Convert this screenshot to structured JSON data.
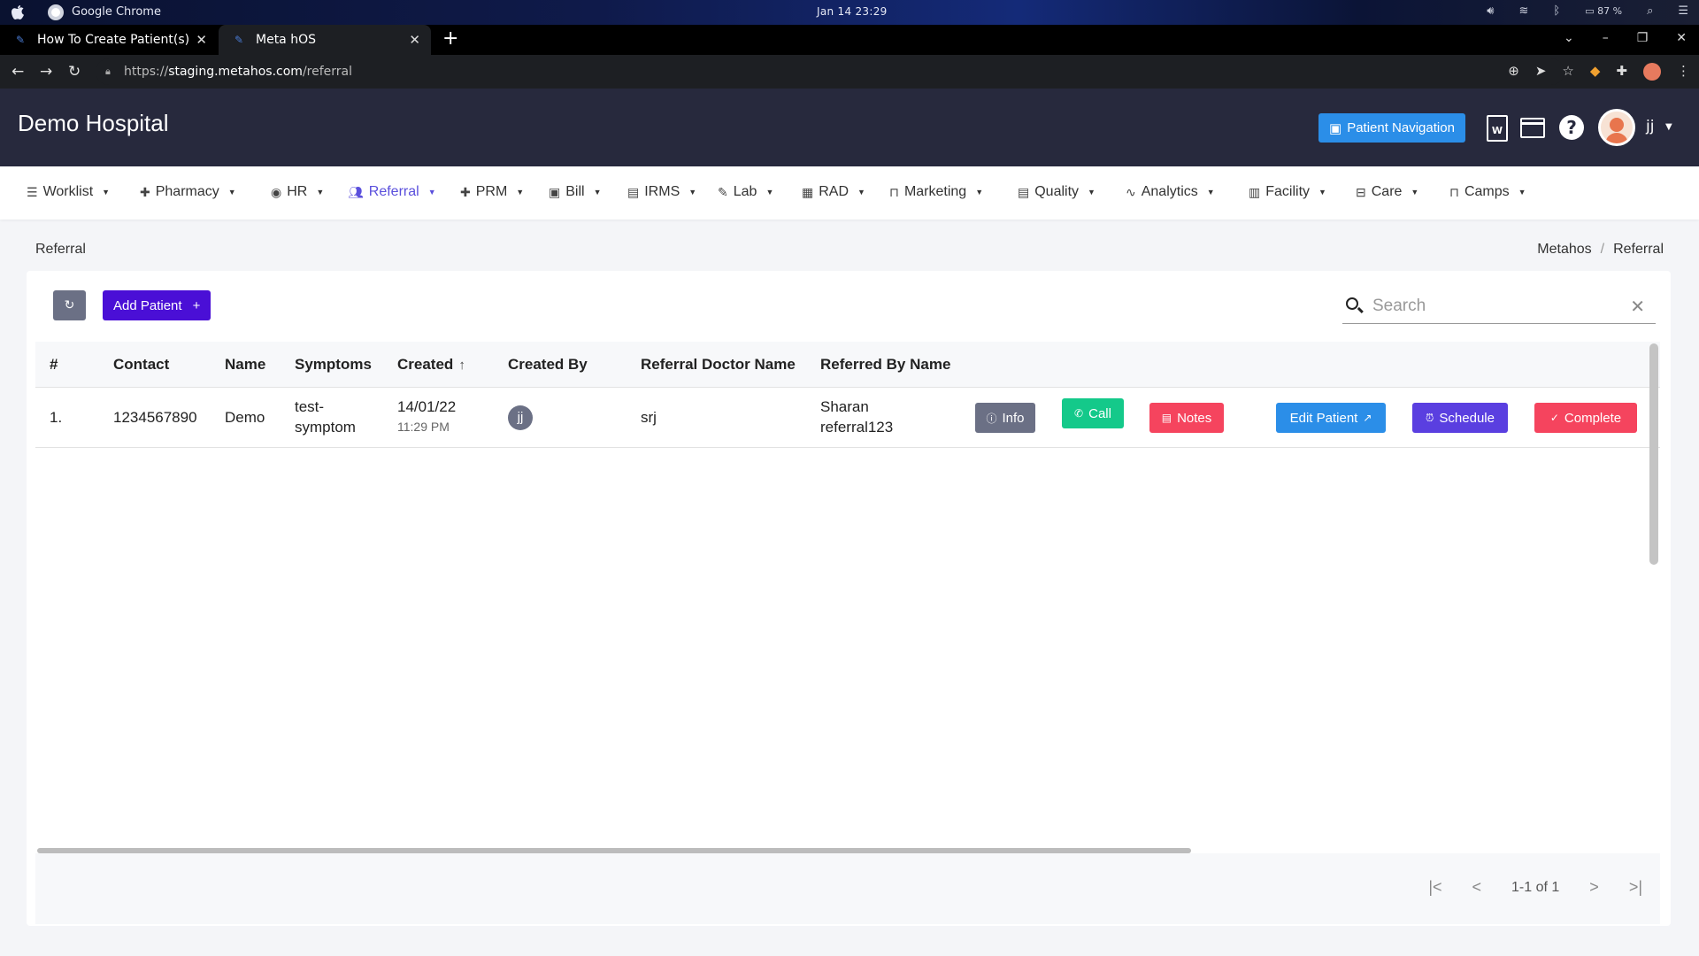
{
  "os": {
    "app_name": "Google Chrome",
    "clock": "Jan 14  23:29",
    "battery": "87 %",
    "icons": [
      "volume-icon",
      "wifi-icon",
      "bluetooth-icon",
      "battery-icon",
      "search-icon",
      "settings-icon"
    ]
  },
  "browser": {
    "tabs": [
      {
        "title": "How To Create Patient(s)"
      },
      {
        "title": "Meta hOS"
      }
    ],
    "url_scheme": "https://",
    "url_host": "staging.metahos.com",
    "url_path": "/referral"
  },
  "header": {
    "title": "Demo Hospital",
    "patient_nav_label": "Patient Navigation",
    "doc_icon_letter": "W",
    "help_label": "?",
    "user_name": "jj"
  },
  "menu": [
    {
      "label": "Worklist",
      "icon": "list-icon"
    },
    {
      "label": "Pharmacy",
      "icon": "plus-icon"
    },
    {
      "label": "HR",
      "icon": "user-circle-icon"
    },
    {
      "label": "Referral",
      "icon": "users-icon",
      "active": true
    },
    {
      "label": "PRM",
      "icon": "plus-icon"
    },
    {
      "label": "Bill",
      "icon": "money-icon"
    },
    {
      "label": "IRMS",
      "icon": "form-icon"
    },
    {
      "label": "Lab",
      "icon": "pen-icon"
    },
    {
      "label": "RAD",
      "icon": "film-icon"
    },
    {
      "label": "Marketing",
      "icon": "bag-icon"
    },
    {
      "label": "Quality",
      "icon": "form-icon"
    },
    {
      "label": "Analytics",
      "icon": "pulse-icon"
    },
    {
      "label": "Facility",
      "icon": "building-icon"
    },
    {
      "label": "Care",
      "icon": "bed-icon"
    },
    {
      "label": "Camps",
      "icon": "briefcase-icon"
    }
  ],
  "page": {
    "title": "Referral",
    "breadcrumb": [
      "Metahos",
      "Referral"
    ],
    "add_patient_label": "Add Patient",
    "search_placeholder": "Search"
  },
  "table": {
    "columns": [
      "#",
      "Contact",
      "Name",
      "Symptoms",
      "Created",
      "Created By",
      "Referral Doctor Name",
      "Referred By Name"
    ],
    "rows": [
      {
        "index": "1.",
        "contact": "1234567890",
        "name": "Demo",
        "symptoms_line1": "test-",
        "symptoms_line2": "symptom",
        "created_date": "14/01/22",
        "created_time": "11:29 PM",
        "created_by": "jj",
        "referral_doctor": "srj",
        "referred_by_line1": "Sharan",
        "referred_by_line2": "referral123"
      }
    ],
    "actions": [
      {
        "label": "Info",
        "color": "#6b7085"
      },
      {
        "label": "Call",
        "color": "#14c98a"
      },
      {
        "label": "Notes",
        "color": "#f5445e"
      },
      {
        "label": "Edit Patient",
        "color": "#2b8ee8"
      },
      {
        "label": "Schedule",
        "color": "#5a3fe0"
      },
      {
        "label": "Complete",
        "color": "#f5445e"
      }
    ]
  },
  "pagination": {
    "range": "1-1 of 1"
  },
  "colors": {
    "header_bg": "#27293d",
    "accent": "#5a4fdc",
    "primary_button": "#4a0fd6"
  }
}
